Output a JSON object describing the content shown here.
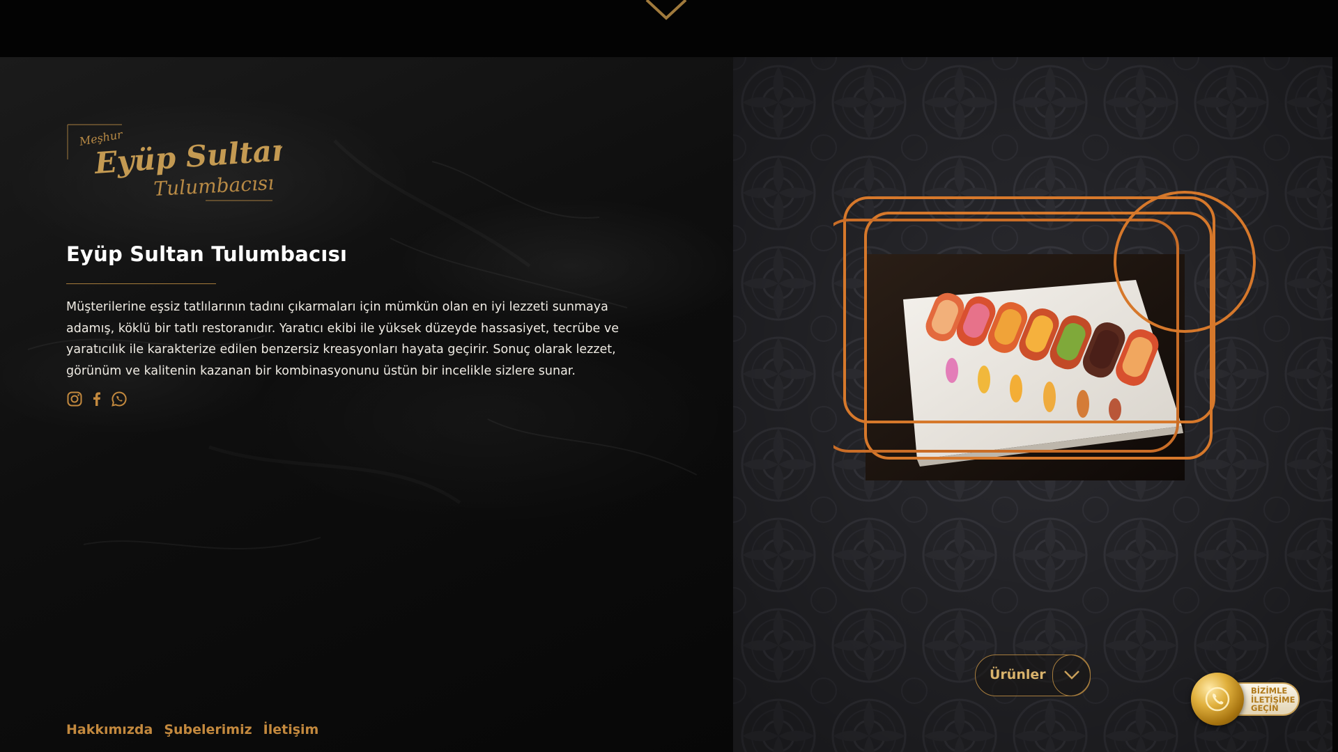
{
  "brand": {
    "logo_small": "Meşhur",
    "logo_main": "Eyüp Sultan",
    "logo_sub": "Tulumbacısı"
  },
  "about": {
    "title": "Eyüp Sultan Tulumbacısı",
    "description": "Müşterilerine eşsiz tatlılarının tadını çıkarmaları için mümkün olan en iyi lezzeti sunmaya adamış, köklü bir tatlı restoranıdır. Yaratıcı ekibi ile yüksek düzeyde hassasiyet, tecrübe ve yaratıcılık ile karakterize edilen benzersiz kreasyonları hayata geçirir. Sonuç olarak lezzet, görünüm ve kalitenin kazanan bir kombinasyonunu üstün bir incelikle sizlere sunar."
  },
  "socials": [
    {
      "icon": "instagram-icon"
    },
    {
      "icon": "facebook-icon"
    },
    {
      "icon": "whatsapp-icon"
    }
  ],
  "footer_nav": [
    {
      "label": "Hakkımızda"
    },
    {
      "label": "Şubelerimiz"
    },
    {
      "label": "İletişim"
    }
  ],
  "products_button": {
    "label": "Ürünler",
    "icon": "chevron-down-icon"
  },
  "contact_badge": {
    "line1": "BİZİMLE",
    "line2": "İLETİŞİME",
    "line3": "GEÇİN",
    "icon": "phone-icon"
  },
  "colors": {
    "accent_gold": "#c3893e",
    "frame_orange": "#d6782b",
    "background": "#000000"
  }
}
